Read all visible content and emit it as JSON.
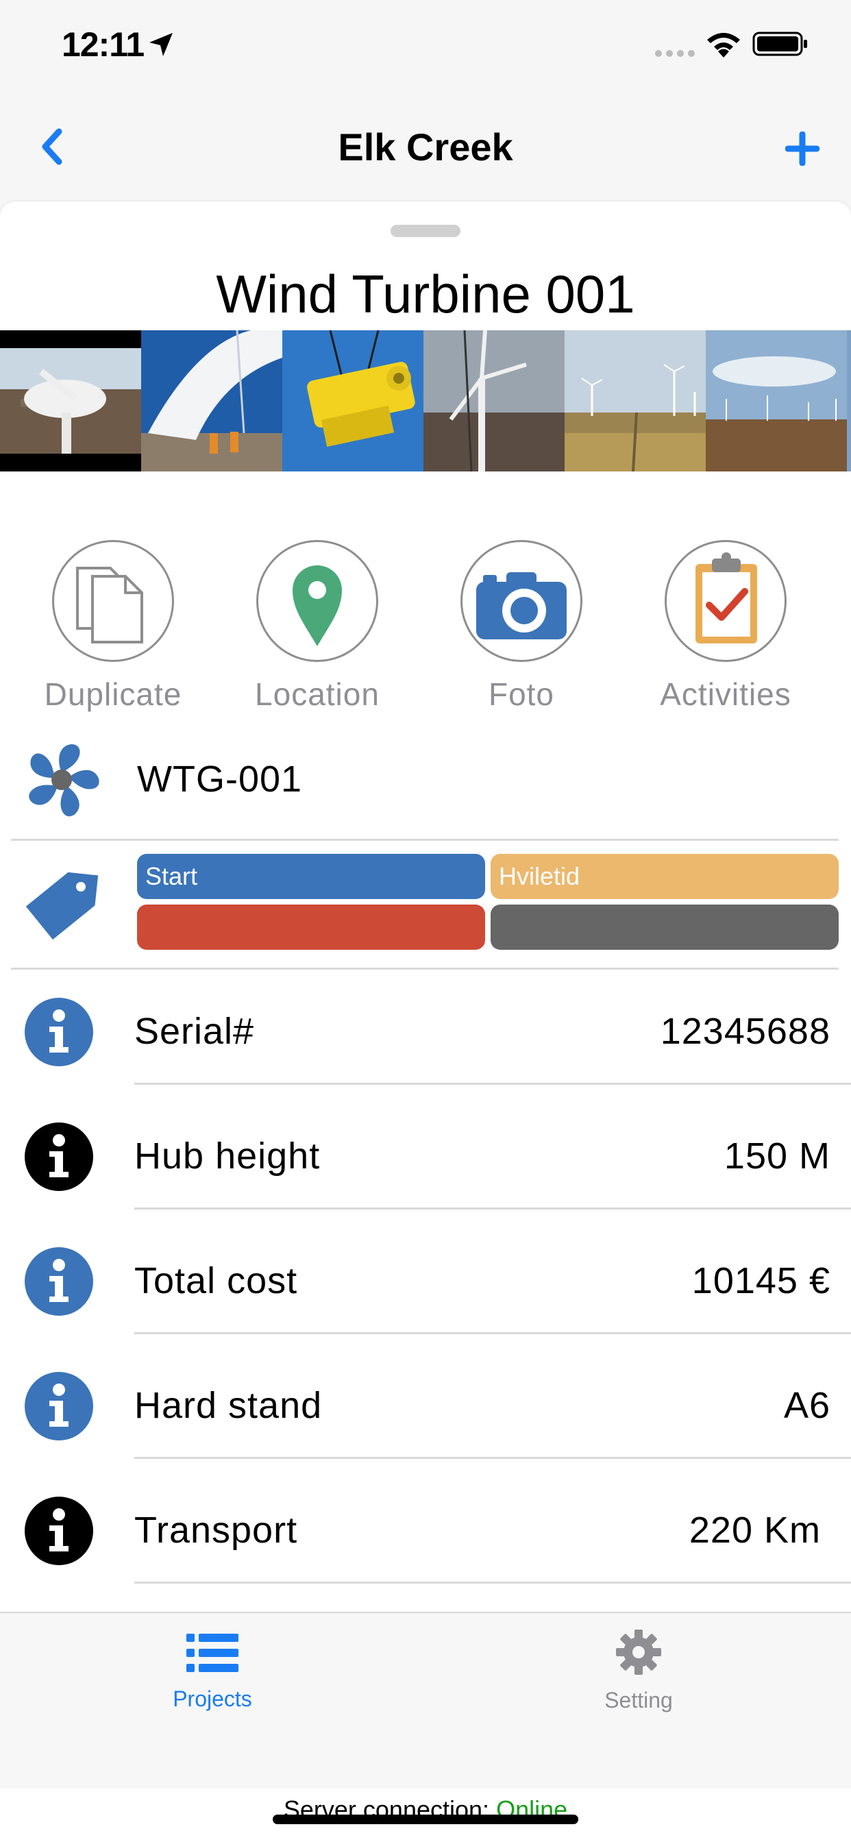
{
  "status_bar": {
    "time": "12:11"
  },
  "nav": {
    "title": "Elk Creek"
  },
  "sheet": {
    "title": "Wind Turbine 001"
  },
  "photos": [
    "turbine-nacelle-photo",
    "turbine-blade-photo",
    "yellow-hub-crane-photo",
    "tower-crane-photo",
    "wind-farm-field-photo",
    "wind-farm-horizon-photo"
  ],
  "actions": [
    {
      "label": "Duplicate",
      "icon": "duplicate-icon"
    },
    {
      "label": "Location",
      "icon": "location-pin-icon"
    },
    {
      "label": "Foto",
      "icon": "camera-icon"
    },
    {
      "label": "Activities",
      "icon": "clipboard-check-icon"
    }
  ],
  "code_row": {
    "value": "WTG-001",
    "icon": "fan-icon"
  },
  "tags": [
    {
      "label": "Start",
      "color": "#3b74b8"
    },
    {
      "label": "Hviletid",
      "color": "#ebb86e"
    },
    {
      "label": "",
      "color": "#cd4a36"
    },
    {
      "label": "",
      "color": "#666666"
    }
  ],
  "info_rows": [
    {
      "label": "Serial#",
      "value": "12345688",
      "icon_color": "#3b74b8"
    },
    {
      "label": "Hub height",
      "value": "150 M",
      "icon_color": "#000000"
    },
    {
      "label": "Total cost",
      "value": "10145 €",
      "icon_color": "#3b74b8"
    },
    {
      "label": "Hard stand",
      "value": "A6",
      "icon_color": "#3b74b8"
    },
    {
      "label": "Transport",
      "value": "220 Km",
      "icon_color": "#000000"
    }
  ],
  "tab_bar": {
    "projects": "Projects",
    "setting": "Setting",
    "active_color": "#1a7cf2",
    "inactive_color": "#8e8e93"
  },
  "server": {
    "label": "Server connection:",
    "status": "Online",
    "status_color": "#1a9e1a"
  }
}
